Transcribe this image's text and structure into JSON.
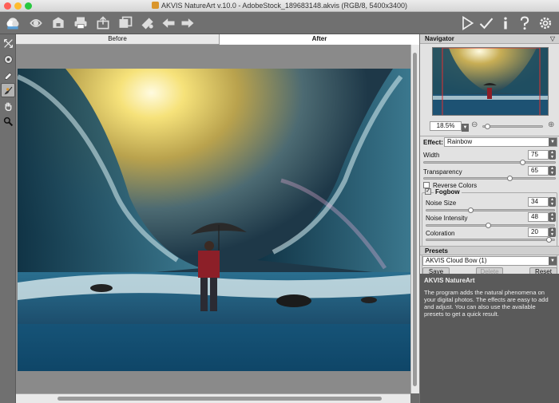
{
  "window": {
    "title": "AKVIS NatureArt v.10.0 - AdobeStock_189683148.akvis (RGB/8, 5400x3400)"
  },
  "toolbar": {
    "left_icons": [
      "app-logo-icon",
      "open-icon",
      "save-icon",
      "print-icon",
      "share-icon",
      "batch-icon",
      "brush-settings-icon",
      "undo-arrow-icon",
      "redo-arrow-icon"
    ],
    "right_icons": [
      "run-icon",
      "apply-icon",
      "info-icon",
      "help-icon",
      "settings-icon"
    ]
  },
  "left_tools": [
    "crop-icon",
    "color-picker-icon",
    "eraser-icon",
    "effect-brush-icon",
    "hand-icon",
    "zoom-icon"
  ],
  "tabs": {
    "before": "Before",
    "after": "After"
  },
  "navigator": {
    "title": "Navigator",
    "zoom": "18.5%"
  },
  "effect": {
    "label": "Effect:",
    "value": "Rainbow",
    "width_label": "Width",
    "width_value": "75",
    "transparency_label": "Transparency",
    "transparency_value": "65",
    "reverse_colors_label": "Reverse Colors",
    "reverse_colors_checked": false,
    "fogbow_label": "Fogbow",
    "fogbow_checked": true,
    "noise_size_label": "Noise Size",
    "noise_size_value": "34",
    "noise_intensity_label": "Noise Intensity",
    "noise_intensity_value": "48",
    "coloration_label": "Coloration",
    "coloration_value": "20"
  },
  "presets": {
    "title": "Presets",
    "value": "AKVIS Cloud Bow (1)",
    "save": "Save",
    "delete": "Delete",
    "reset": "Reset"
  },
  "info": {
    "title": "AKVIS NatureArt",
    "text": "The program adds the natural phenomena on your digital photos. The effects are easy to add and adjust. You can also use the available presets to get a quick result."
  },
  "colors": {
    "close": "#ff5f57",
    "minimize": "#febc2e",
    "zoom": "#28c840",
    "panel": "#e2e2e2",
    "info_bg": "#5a5a5a"
  }
}
